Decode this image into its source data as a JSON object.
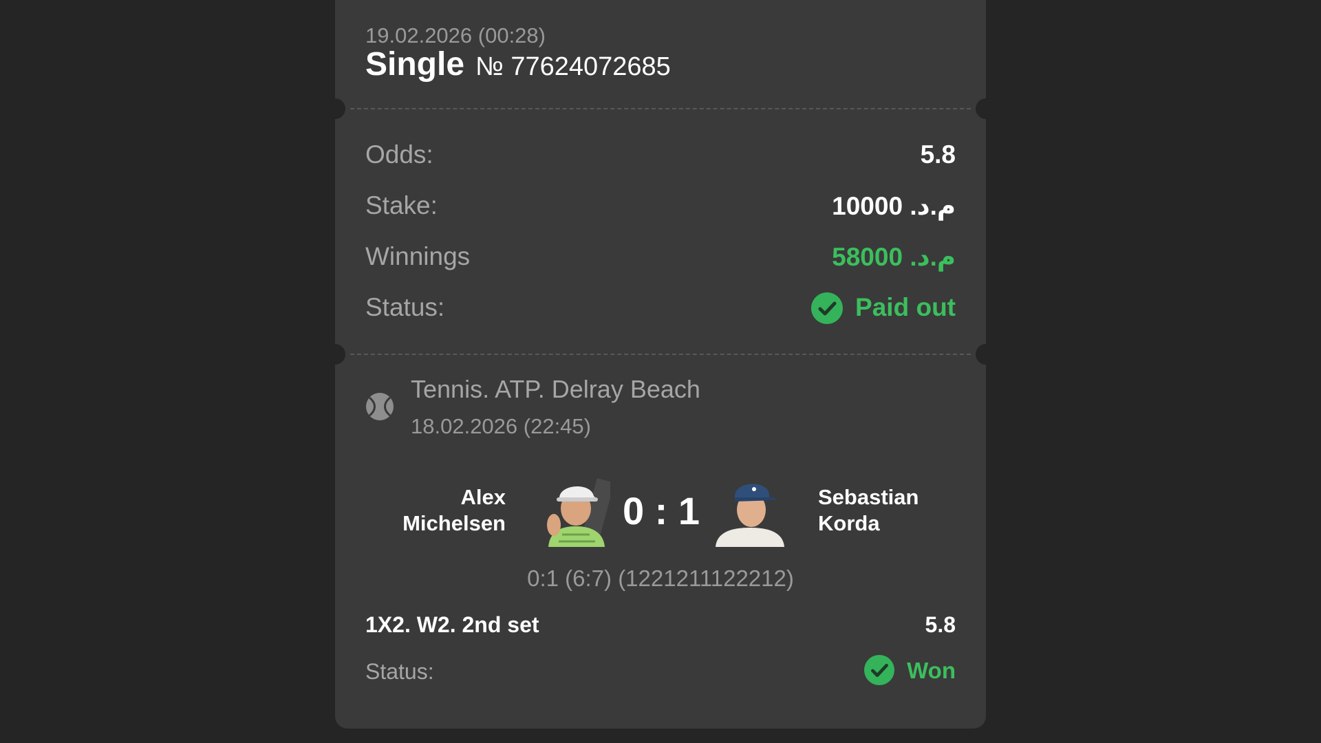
{
  "bet": {
    "datetime": "19.02.2026 (00:28)",
    "type": "Single",
    "number": "№ 77624072685"
  },
  "summary": {
    "odds_label": "Odds:",
    "odds_value": "5.8",
    "stake_label": "Stake:",
    "stake_value": "م.د. 10000",
    "winnings_label": "Winnings",
    "winnings_value": "م.د. 58000",
    "status_label": "Status:",
    "status_value": "Paid out"
  },
  "event": {
    "sport_icon": "tennis-ball-icon",
    "league": "Tennis. ATP. Delray Beach",
    "datetime": "18.02.2026 (22:45)",
    "player1_line1": "Alex",
    "player1_line2": "Michelsen",
    "player2_line1": "Sebastian",
    "player2_line2": "Korda",
    "score": "0 : 1",
    "sets_detail": "0:1 (6:7) (1221211122212)",
    "market": "1X2. W2. 2nd set",
    "market_odds": "5.8",
    "status_label": "Status:",
    "status_value": "Won"
  },
  "colors": {
    "background": "#252525",
    "card": "#3a3a3a",
    "accent_green": "#3bbf5d",
    "muted_text": "#a6a6a6"
  }
}
